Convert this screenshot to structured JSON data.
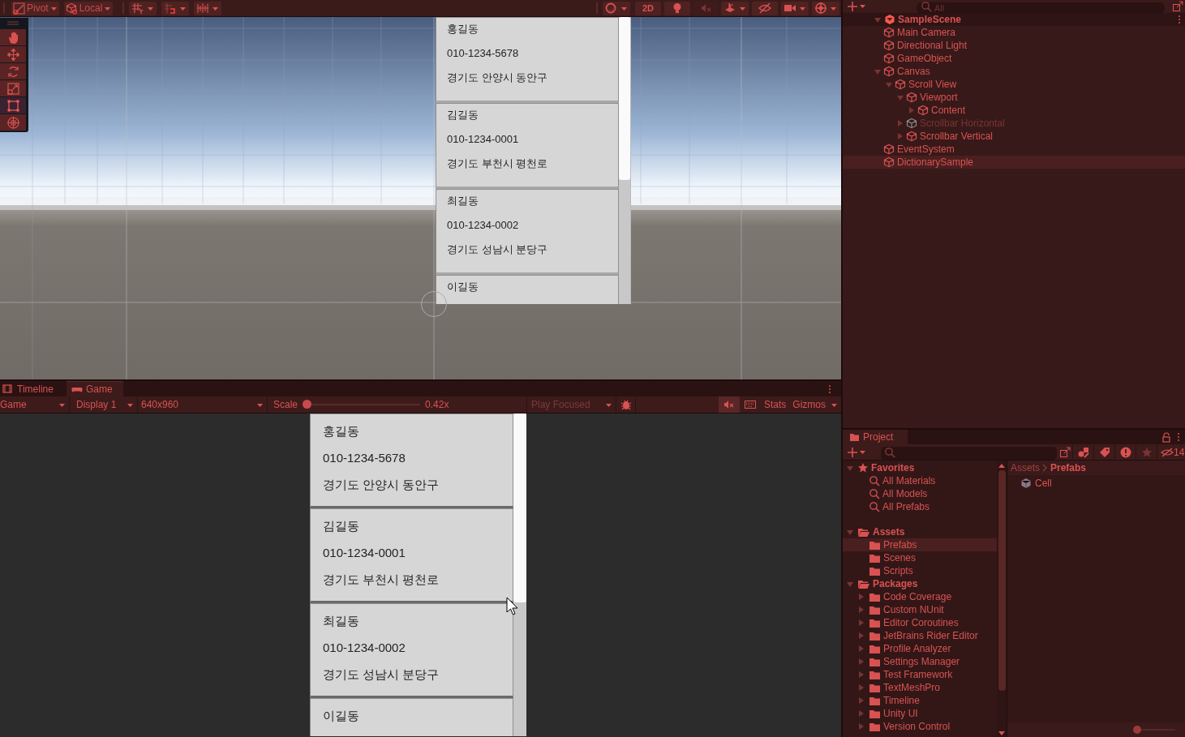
{
  "scene_toolbar": {
    "pivot": "Pivot",
    "local": "Local",
    "mode_2d": "2D"
  },
  "view_toggles": [
    {
      "kind": "lighting",
      "on": true
    },
    {
      "kind": "audio",
      "on": false
    },
    {
      "kind": "visibility",
      "on": true
    }
  ],
  "scene_tools": [
    {
      "kind": "hand",
      "selected": false
    },
    {
      "kind": "move",
      "selected": false
    },
    {
      "kind": "rotate",
      "selected": false
    },
    {
      "kind": "scale",
      "selected": false
    },
    {
      "kind": "rect",
      "selected": true
    },
    {
      "kind": "transform",
      "selected": false
    }
  ],
  "scene_view": {
    "cells": [
      {
        "name": "홍길동",
        "phone": "010-1234-5678",
        "address": "경기도 안양시 동안구"
      },
      {
        "name": "김길동",
        "phone": "010-1234-0001",
        "address": "경기도 부천시 평천로"
      },
      {
        "name": "최길동",
        "phone": "010-1234-0002",
        "address": "경기도 성남시 분당구"
      },
      {
        "name": "이길동"
      }
    ]
  },
  "game_tabs": [
    {
      "kind": "timeline",
      "label": "Timeline",
      "selected": false
    },
    {
      "kind": "game",
      "label": "Game",
      "selected": true
    }
  ],
  "game_toolbar": {
    "view": "Game",
    "display": "Display 1",
    "resolution": "640x960",
    "scale": {
      "label": "Scale",
      "level": 0,
      "reading": "0.42x"
    },
    "play_mode": "Play Focused",
    "stats": "Stats",
    "gizmos": "Gizmos"
  },
  "game_view": {
    "cells": [
      {
        "name": "홍길동",
        "phone": "010-1234-5678",
        "address": "경기도 안양시 동안구"
      },
      {
        "name": "김길동",
        "phone": "010-1234-0001",
        "address": "경기도 부천시 평천로"
      },
      {
        "name": "최길동",
        "phone": "010-1234-0002",
        "address": "경기도 성남시 분당구"
      },
      {
        "name": "이길동"
      }
    ]
  },
  "hierarchy": {
    "search_placeholder": "All",
    "scene": {
      "label": "SampleScene",
      "expanded": true
    },
    "items": [
      {
        "label": "Main Camera",
        "selected": false,
        "disabled": false
      },
      {
        "label": "Directional Light",
        "selected": false,
        "disabled": false
      },
      {
        "label": "GameObject",
        "selected": false,
        "disabled": false
      },
      {
        "label": "Canvas",
        "selected": false,
        "disabled": false,
        "expanded": true,
        "children": [
          {
            "label": "Scroll View",
            "selected": false,
            "disabled": false,
            "expanded": true,
            "children": [
              {
                "label": "Viewport",
                "selected": false,
                "disabled": false,
                "expanded": true,
                "children": [
                  {
                    "label": "Content",
                    "selected": false,
                    "disabled": false,
                    "expanded": false
                  }
                ]
              },
              {
                "label": "Scrollbar Horizontal",
                "selected": false,
                "disabled": true,
                "expanded": false
              },
              {
                "label": "Scrollbar Vertical",
                "selected": false,
                "disabled": false,
                "expanded": false
              }
            ]
          }
        ]
      },
      {
        "label": "EventSystem",
        "selected": false,
        "disabled": false
      },
      {
        "label": "DictionarySample",
        "selected": true,
        "disabled": false
      }
    ]
  },
  "project": {
    "tab": "Project",
    "hidden_count": "14",
    "tree": [
      {
        "kind": "favorites",
        "label": "Favorites",
        "expanded": true,
        "selected": false,
        "children": [
          {
            "kind": "search",
            "label": "All Materials",
            "selected": false
          },
          {
            "kind": "search",
            "label": "All Models",
            "selected": false
          },
          {
            "kind": "search",
            "label": "All Prefabs",
            "selected": false
          }
        ]
      },
      {
        "kind": "folder",
        "label": "Assets",
        "expanded": true,
        "selected": false,
        "children": [
          {
            "kind": "folder",
            "label": "Prefabs",
            "selected": true
          },
          {
            "kind": "folder",
            "label": "Scenes",
            "selected": false
          },
          {
            "kind": "folder",
            "label": "Scripts",
            "selected": false
          }
        ]
      },
      {
        "kind": "folder",
        "label": "Packages",
        "expanded": true,
        "selected": false,
        "children": [
          {
            "kind": "folder",
            "label": "Code Coverage",
            "expanded": false,
            "selected": false
          },
          {
            "kind": "folder",
            "label": "Custom NUnit",
            "expanded": false,
            "selected": false
          },
          {
            "kind": "folder",
            "label": "Editor Coroutines",
            "expanded": false,
            "selected": false
          },
          {
            "kind": "folder",
            "label": "JetBrains Rider Editor",
            "expanded": false,
            "selected": false
          },
          {
            "kind": "folder",
            "label": "Profile Analyzer",
            "expanded": false,
            "selected": false
          },
          {
            "kind": "folder",
            "label": "Settings Manager",
            "expanded": false,
            "selected": false
          },
          {
            "kind": "folder",
            "label": "Test Framework",
            "expanded": false,
            "selected": false
          },
          {
            "kind": "folder",
            "label": "TextMeshPro",
            "expanded": false,
            "selected": false
          },
          {
            "kind": "folder",
            "label": "Timeline",
            "expanded": false,
            "selected": false
          },
          {
            "kind": "folder",
            "label": "Unity UI",
            "expanded": false,
            "selected": false
          },
          {
            "kind": "folder",
            "label": "Version Control",
            "expanded": false,
            "selected": false
          }
        ]
      }
    ],
    "breadcrumb": [
      "Assets",
      "Prefabs"
    ],
    "assets": [
      {
        "label": "Cell"
      }
    ],
    "zoom": {
      "level": 0
    }
  }
}
